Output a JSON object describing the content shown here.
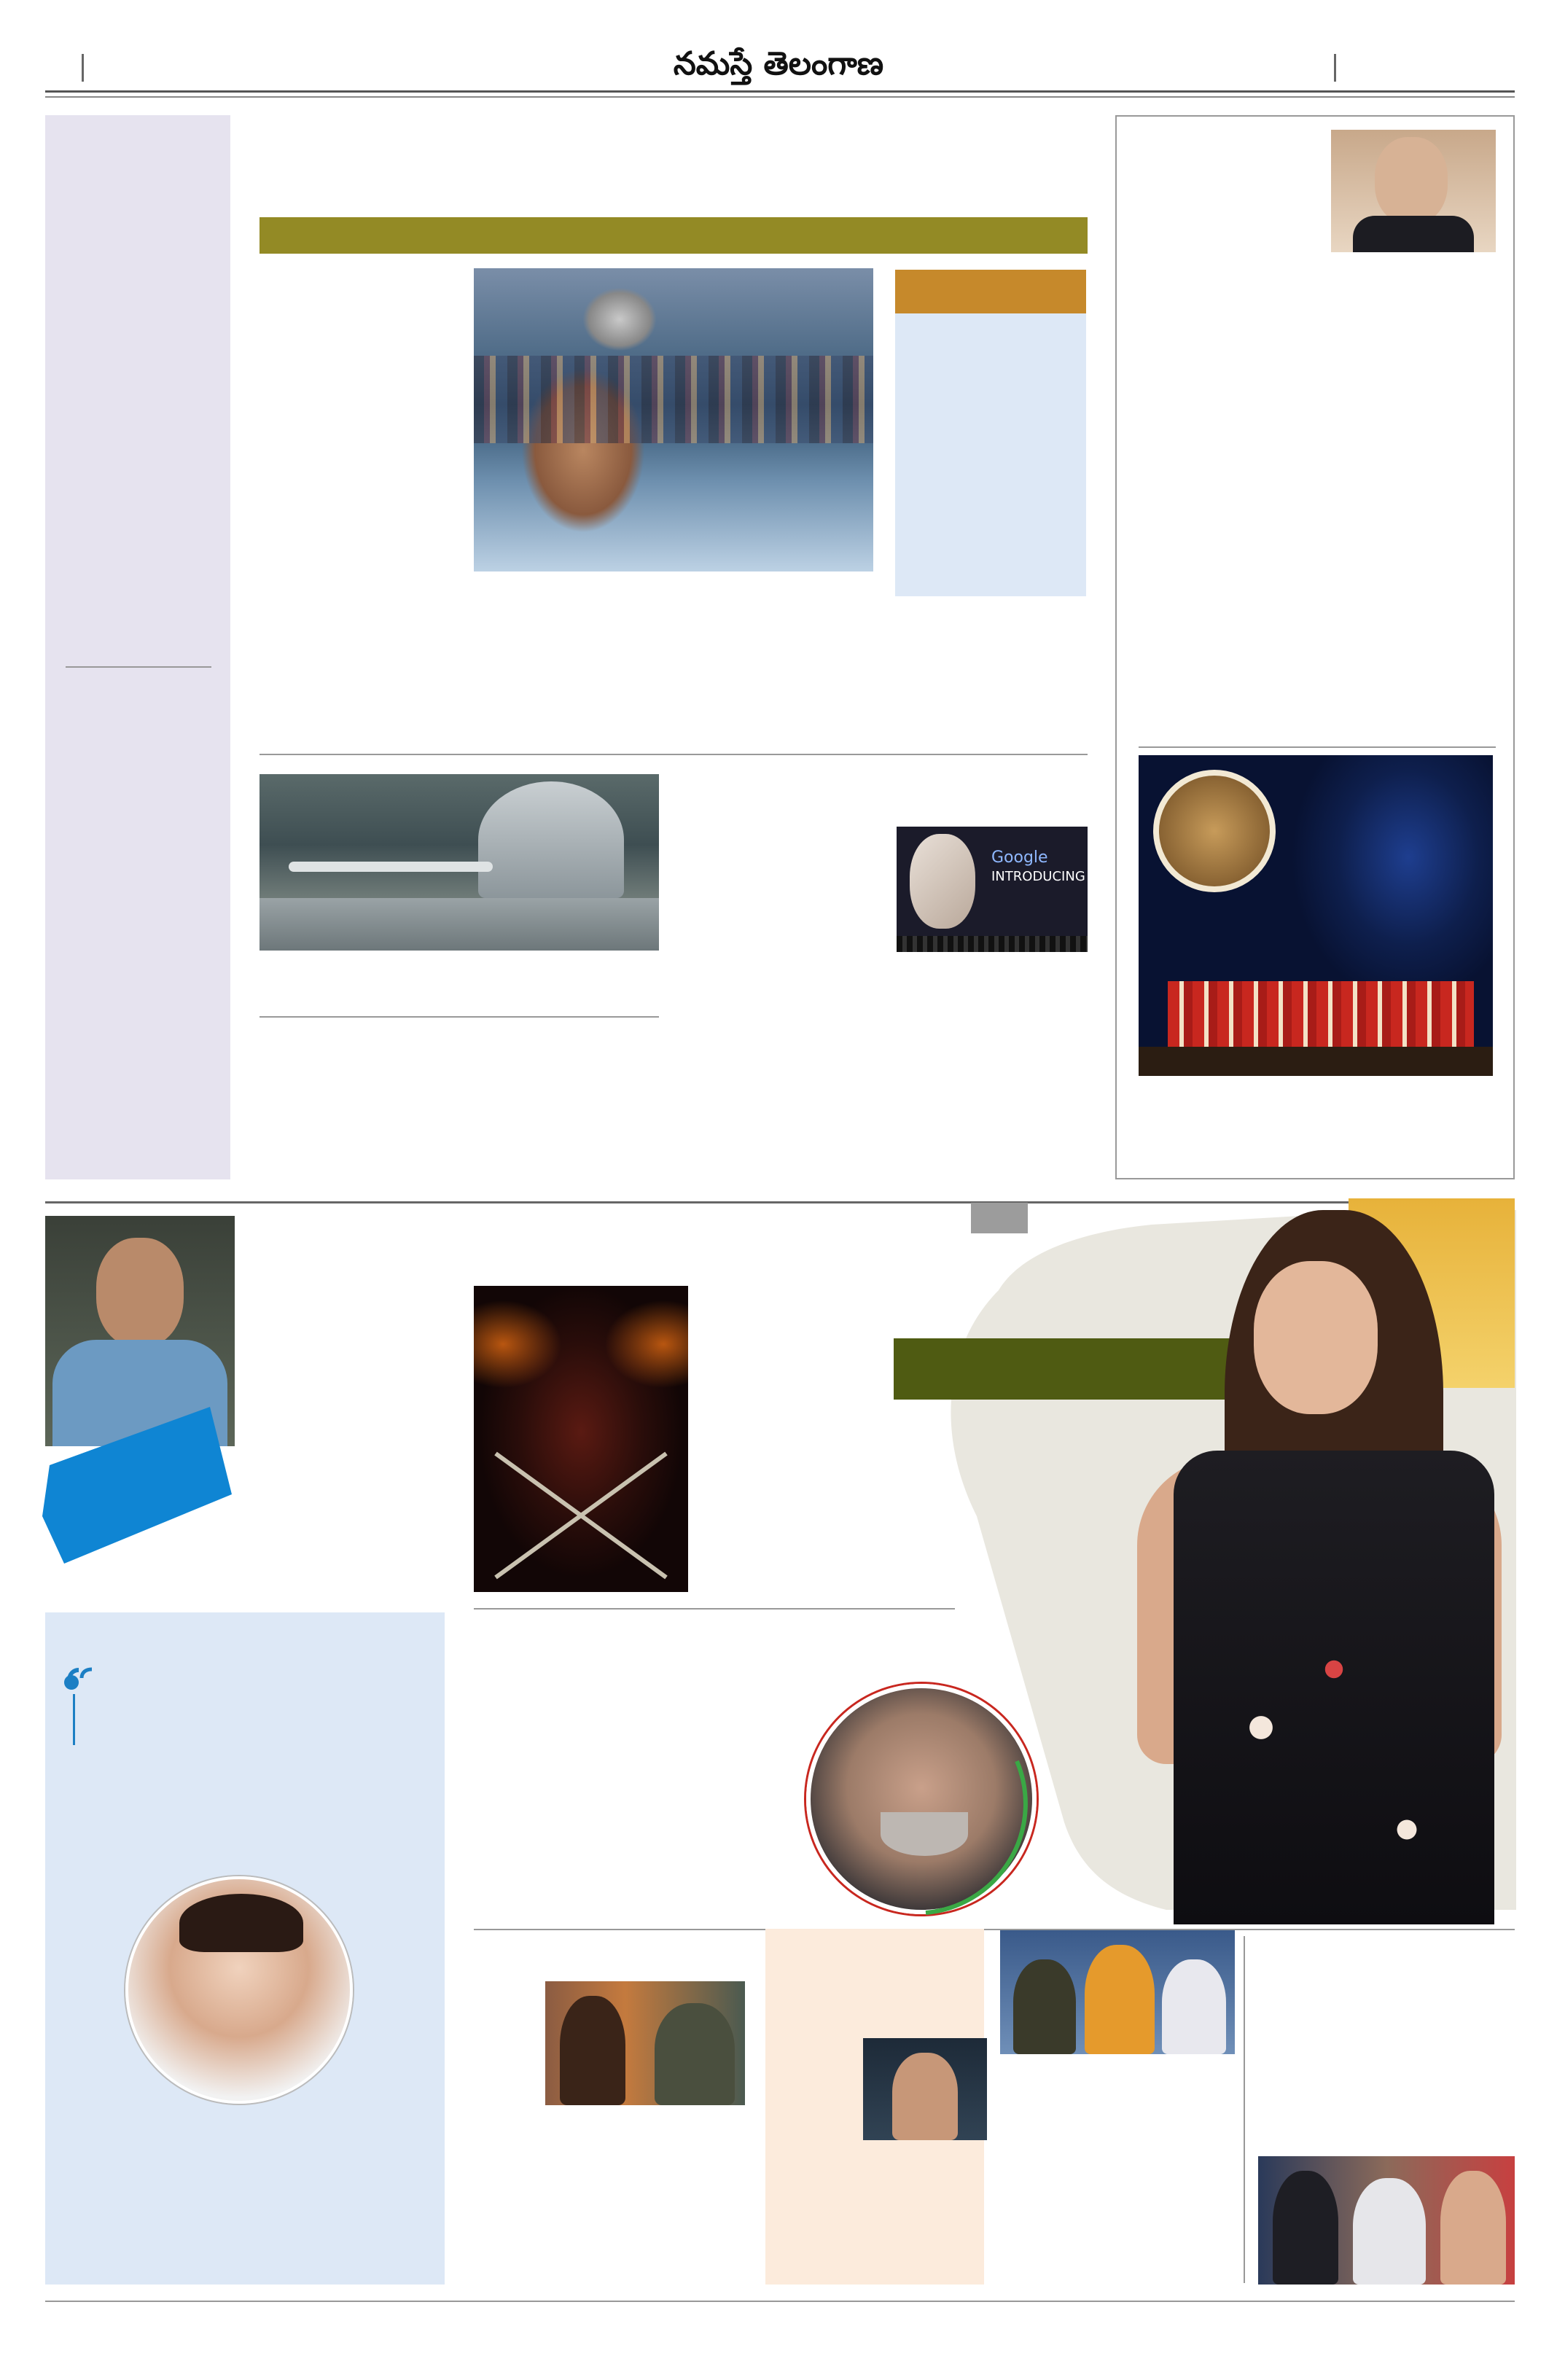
{
  "masthead": {
    "title": "నమస్తే తెలంగాణ"
  },
  "photo_google_text": {
    "brand": "Google",
    "line": "INTRODUCING"
  },
  "colors": {
    "sidebar_lavender": "#e6e3ef",
    "olive_bar": "#938a25",
    "orange_bar": "#c6892b",
    "light_blue_box": "#dde8f6",
    "dark_green_bar": "#4f5b12",
    "blue_shape": "#0f85d3",
    "peach_box": "#fcebdc",
    "quote_blue": "#1c7fc4"
  }
}
